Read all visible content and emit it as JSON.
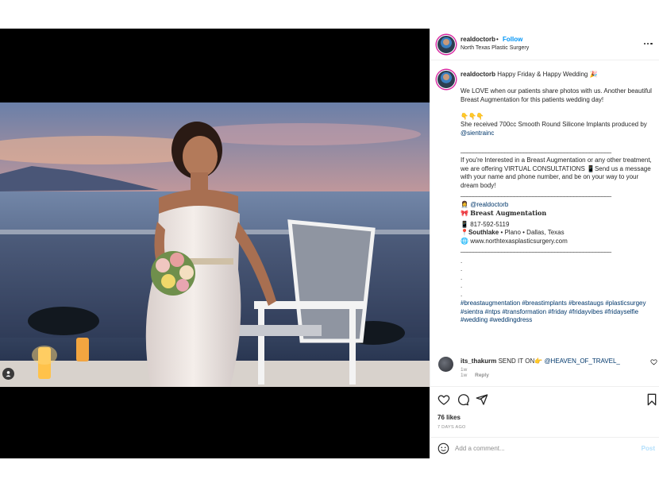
{
  "post": {
    "username": "realdoctorb",
    "follow_label": "Follow",
    "separator": "•",
    "location": "North Texas Plastic Surgery"
  },
  "caption": {
    "username": "realdoctorb",
    "headline": "Happy Friday & Happy Wedding 🎉",
    "para1": "We LOVE when our patients share photos with us. Another beautiful Breast Augmentation for this patients wedding day!",
    "emojis": "👇👇👇",
    "para2_text": "She received 700cc Smooth Round Silicone Implants produced by",
    "para2_mention": "@sientrainc",
    "rule": "________________________________________________",
    "para3": "If you're Interested in a Breast Augmentation or any other treatment, we are offering VIRTUAL CONSULTATIONS 📱Send us a message with your name and phone number, and be on your way to your dream body!",
    "contact_handle": "@realdoctorb",
    "contact_service": "Breast Augmentation",
    "contact_phone": "817-592-5119",
    "contact_location_bold": "Southlake",
    "contact_location_rest": "• Plano • Dallas, Texas",
    "contact_website": "www.northtexasplasticsurgery.com",
    "dots": [
      ".",
      ".",
      ".",
      ".",
      "."
    ],
    "hashtags": "#breastaugmentation #breastimplants #breastaugs #plasticsurgey #sientra #ntps #transformation #friday #fridayvibes #fridayselfie #wedding #weddingdress",
    "time": "1w"
  },
  "comment": {
    "username": "its_thakurm",
    "text": "SEND IT ON👉",
    "mention": "@HEAVEN_OF_TRAVEL_",
    "time": "1w",
    "reply_label": "Reply"
  },
  "stats": {
    "likes": "76 likes",
    "posted": "7 DAYS AGO"
  },
  "add_comment": {
    "placeholder": "Add a comment...",
    "post_label": "Post"
  },
  "colors": {
    "link": "#0095f6",
    "mention": "#00376b",
    "muted": "#8e8e8e",
    "post_disabled": "#b2dffc"
  }
}
